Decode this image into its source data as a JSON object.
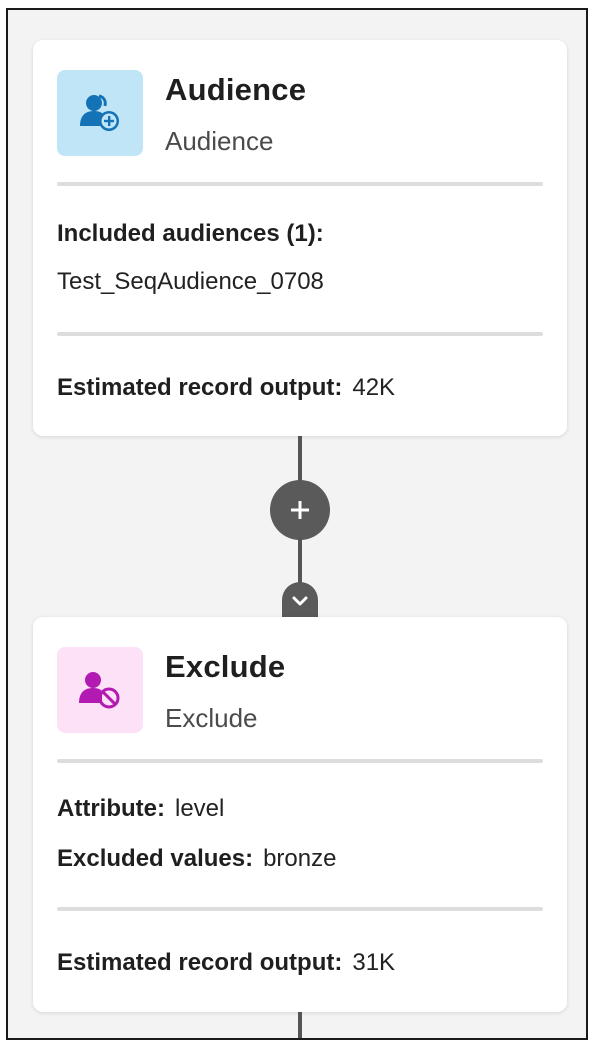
{
  "audience_card": {
    "icon": "audience-add-icon",
    "title": "Audience",
    "subtitle": "Audience",
    "included_label": "Included audiences (1):",
    "included_value": "Test_SeqAudience_0708",
    "estimate_label": "Estimated record output:",
    "estimate_value": "42K"
  },
  "connector": {
    "add_icon": "plus-icon",
    "collapse_icon": "chevron-down-icon"
  },
  "exclude_card": {
    "icon": "audience-exclude-icon",
    "title": "Exclude",
    "subtitle": "Exclude",
    "attribute_label": "Attribute:",
    "attribute_value": "level",
    "excluded_label": "Excluded values:",
    "excluded_value": "bronze",
    "estimate_label": "Estimated record output:",
    "estimate_value": "31K"
  },
  "colors": {
    "audience_icon_bg": "#bfe5f7",
    "audience_icon_fg": "#1473b7",
    "exclude_icon_bg": "#fde1f6",
    "exclude_icon_fg": "#b21ab2",
    "connector": "#5a5a5a",
    "canvas": "#f3f3f3"
  }
}
